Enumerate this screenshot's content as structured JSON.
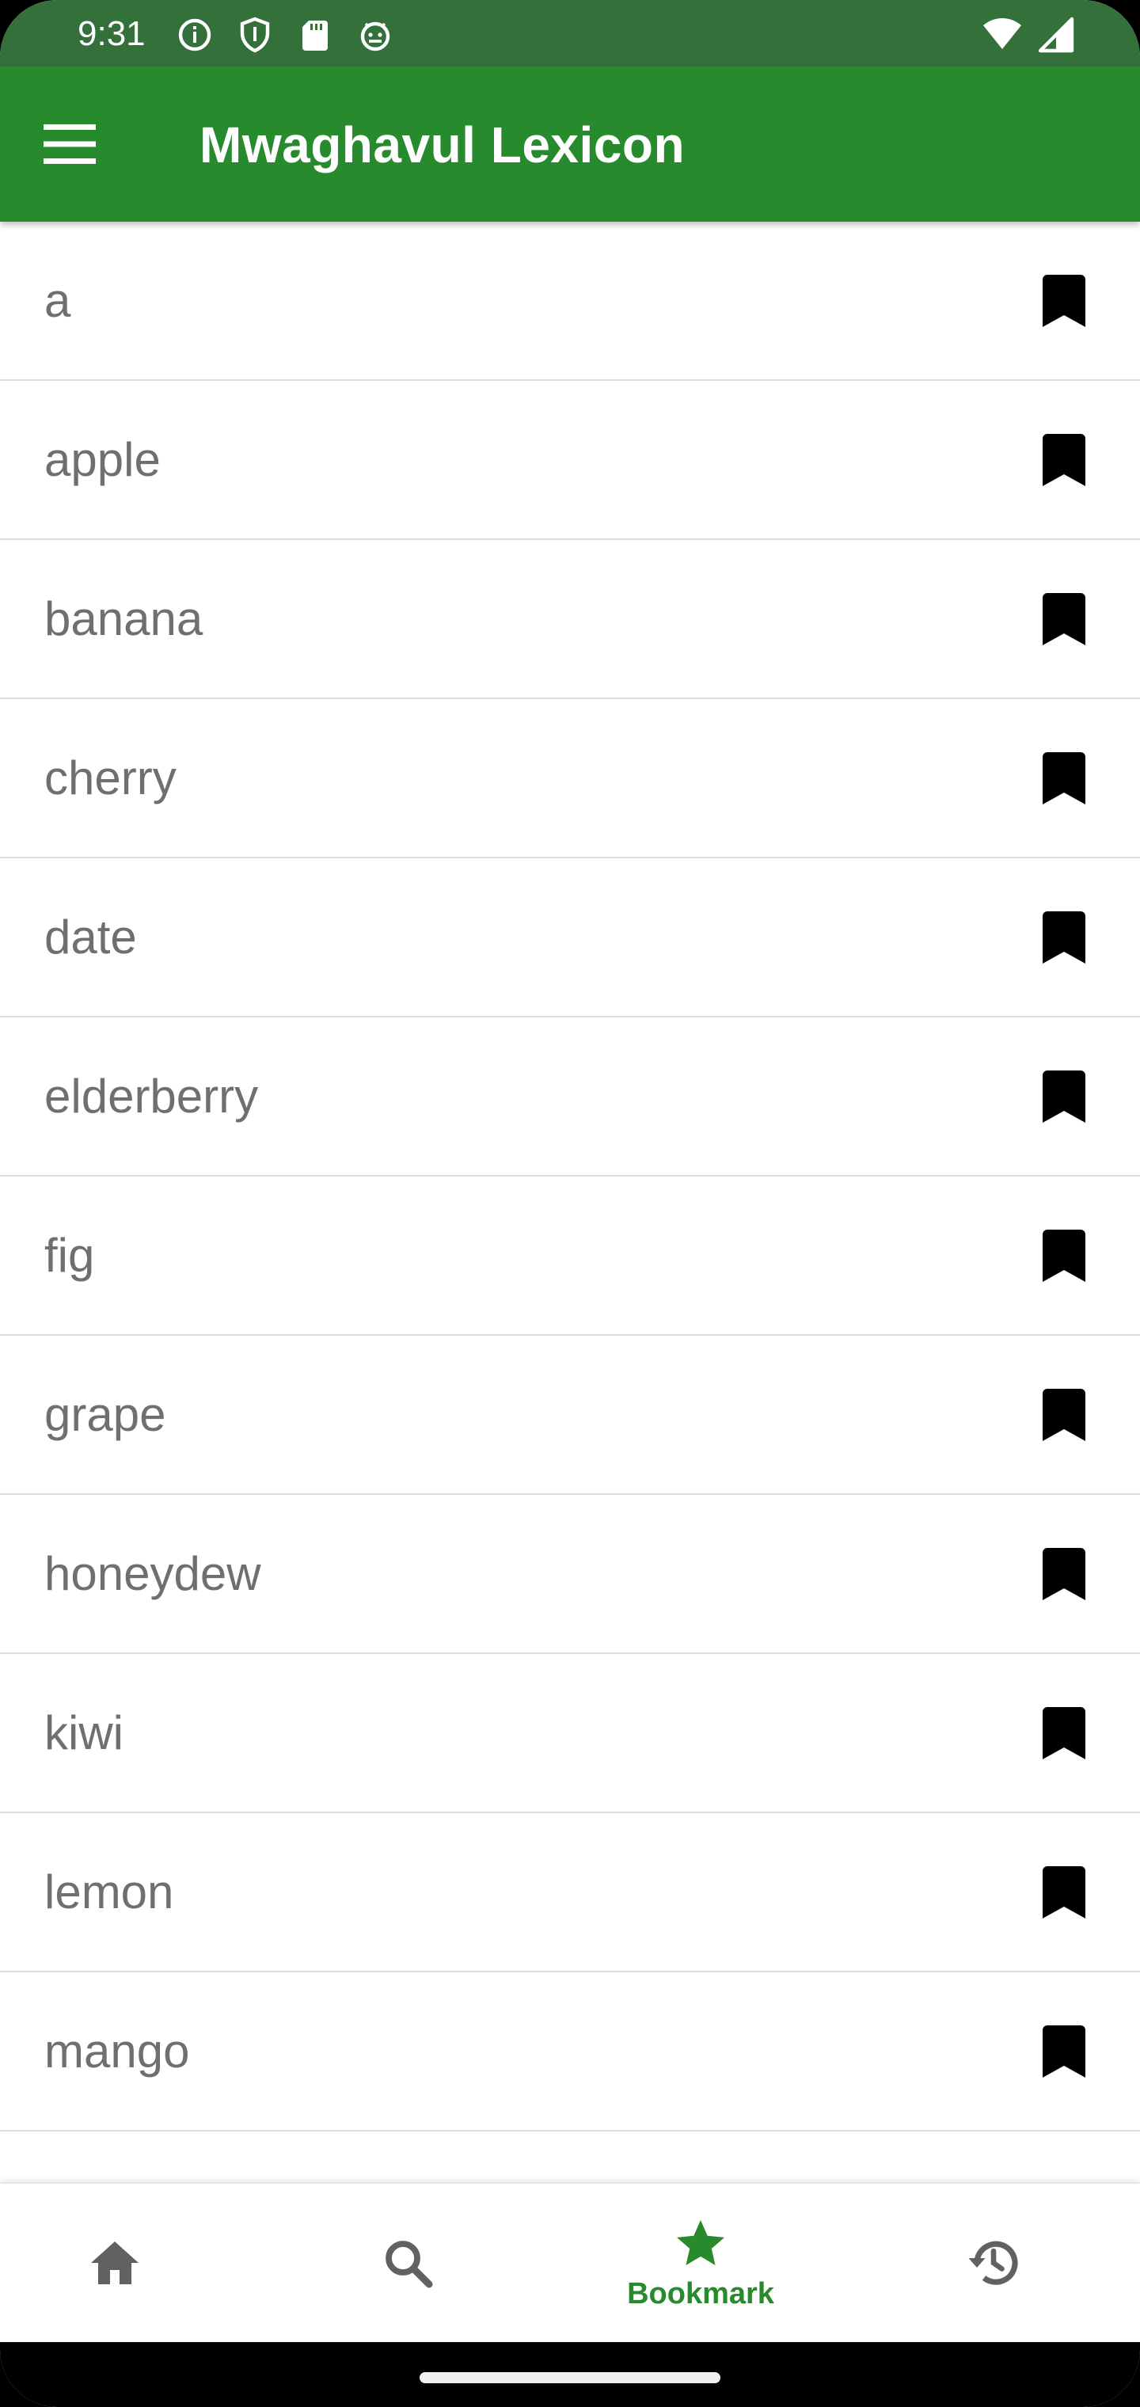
{
  "status_bar": {
    "time": "9:31",
    "left_icons": [
      "info-icon",
      "shield-icon",
      "sd-card-icon",
      "android-icon"
    ],
    "right_icons": [
      "wifi-icon",
      "signal-icon"
    ]
  },
  "app_bar": {
    "title": "Mwaghavul Lexicon",
    "menu_icon": "menu-icon",
    "color": "#278a2c"
  },
  "bookmarks": {
    "items": [
      {
        "word": "a"
      },
      {
        "word": "apple"
      },
      {
        "word": "banana"
      },
      {
        "word": "cherry"
      },
      {
        "word": "date"
      },
      {
        "word": "elderberry"
      },
      {
        "word": "fig"
      },
      {
        "word": "grape"
      },
      {
        "word": "honeydew"
      },
      {
        "word": "kiwi"
      },
      {
        "word": "lemon"
      },
      {
        "word": "mango"
      }
    ],
    "item_icon": "bookmark-icon"
  },
  "bottom_nav": {
    "items": [
      {
        "icon": "home-icon",
        "label": ""
      },
      {
        "icon": "search-icon",
        "label": ""
      },
      {
        "icon": "star-icon",
        "label": "Bookmark",
        "active": true
      },
      {
        "icon": "history-icon",
        "label": ""
      }
    ],
    "active_color": "#278a2c",
    "inactive_color": "#616161"
  }
}
